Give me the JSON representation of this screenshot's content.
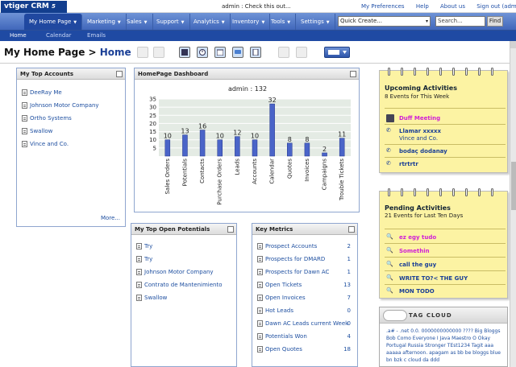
{
  "app": {
    "logo": "vtiger CRM",
    "version": "5"
  },
  "topbar": {
    "message": "admin : Check this out...",
    "links": [
      "My Preferences",
      "Help",
      "About us",
      "Sign out (admin)"
    ]
  },
  "menu": {
    "items": [
      "My Home Page",
      "Marketing",
      "Sales",
      "Support",
      "Analytics",
      "Inventory",
      "Tools",
      "Settings"
    ],
    "quick_create": "Quick Create...",
    "search_placeholder": "Search...",
    "find_label": "Find"
  },
  "subnav": [
    "Home",
    "Calendar",
    "Emails"
  ],
  "page": {
    "title_prefix": "My Home Page > ",
    "title_highlight": "Home"
  },
  "accounts": {
    "title": "My Top Accounts",
    "items": [
      "DeeRay Me",
      "Johnson Motor Company",
      "Ortho Systems",
      "Swallow",
      "Vince and Co."
    ],
    "more": "More..."
  },
  "dashboard": {
    "title": "HomePage Dashboard"
  },
  "chart_data": {
    "type": "bar",
    "title": "admin : 132",
    "categories": [
      "Sales Orders",
      "Potentials",
      "Contacts",
      "Purchase Orders",
      "Leads",
      "Accounts",
      "Calendar",
      "Quotes",
      "Invoices",
      "Campaigns",
      "Trouble Tickets"
    ],
    "values": [
      10,
      13,
      16,
      10,
      12,
      10,
      32,
      8,
      8,
      2,
      11
    ],
    "ylim": [
      0,
      35
    ],
    "yticks": [
      5,
      10,
      15,
      20,
      25,
      30,
      35
    ],
    "grid": true,
    "bar_color": "#4a64c8"
  },
  "potentials": {
    "title": "My Top Open Potentials",
    "items": [
      "Try",
      "Try",
      "Johnson Motor Company",
      "Contrato de Mantenimiento",
      "Swallow"
    ]
  },
  "metrics": {
    "title": "Key Metrics",
    "items": [
      {
        "label": "Prospect Accounts",
        "value": "2"
      },
      {
        "label": "Prospects for DMARD",
        "value": "1"
      },
      {
        "label": "Prospects for Dawn AC",
        "value": "1"
      },
      {
        "label": "Open Tickets",
        "value": "13"
      },
      {
        "label": "Open Invoices",
        "value": "7"
      },
      {
        "label": "Hot Leads",
        "value": "0"
      },
      {
        "label": "Dawn AC Leads current Week",
        "value": "0"
      },
      {
        "label": "Potentials Won",
        "value": "4"
      },
      {
        "label": "Open Quotes",
        "value": "18"
      }
    ]
  },
  "upcoming": {
    "title": "Upcoming Activities",
    "subtitle": "8 Events for This Week",
    "items": [
      {
        "label": "Duff Meeting",
        "sub": ""
      },
      {
        "label": "Llamar xxxxx",
        "sub": "Vince and Co."
      },
      {
        "label": "bodaç dodanay",
        "sub": ""
      },
      {
        "label": "rtrtrtr",
        "sub": ""
      }
    ]
  },
  "pending": {
    "title": "Pending Activities",
    "subtitle": "21 Events for Last Ten Days",
    "items": [
      "ez egy tudo",
      "Somethin",
      "call the guy",
      "WRITE TO?< THE GUY",
      "MON TODO"
    ]
  },
  "tagcloud": {
    "title": "TAG CLOUD",
    "text": ".a# - .net 0.0. 0000000000000 ???? Big Bloggs Bob Como Everyone I Java Maestro O Okay Portugal Russia Stronger TEst1234 Tagit aaa aaaaa afternoon. apagam as bb be bloggs blue bn bzk c cloud da ddd"
  }
}
